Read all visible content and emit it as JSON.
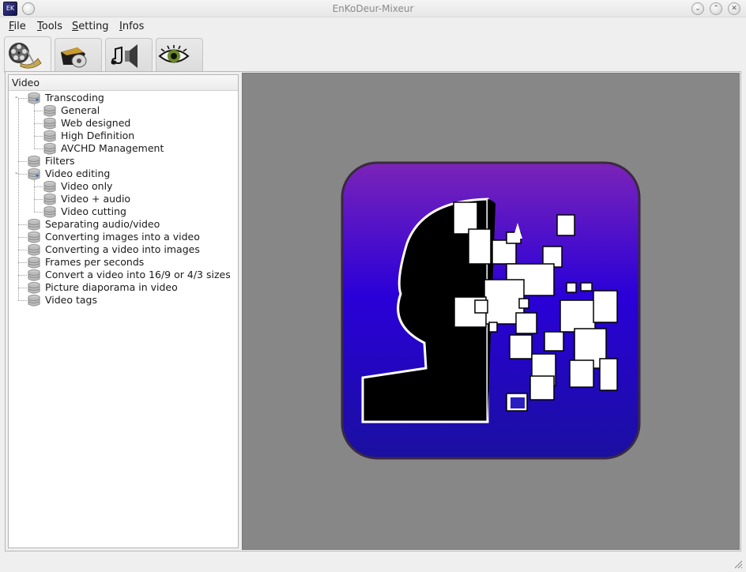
{
  "window": {
    "title": "EnKoDeur-Mixeur",
    "app_icon_label": "EK"
  },
  "menu": {
    "file": {
      "mnemonic": "F",
      "rest": "ile"
    },
    "tools": {
      "mnemonic": "T",
      "rest": "ools"
    },
    "setting": {
      "mnemonic": "S",
      "rest": "etting"
    },
    "infos": {
      "mnemonic": "I",
      "rest": "nfos"
    }
  },
  "tabs": [
    {
      "icon": "film-reel-icon",
      "active": true
    },
    {
      "icon": "camera-disc-icon",
      "active": false
    },
    {
      "icon": "music-speaker-icon",
      "active": false
    },
    {
      "icon": "eye-icon",
      "active": false
    }
  ],
  "tree": {
    "header": "Video",
    "items": [
      {
        "label": "Transcoding",
        "level": 0,
        "expanded": true
      },
      {
        "label": "General",
        "level": 1
      },
      {
        "label": "Web designed",
        "level": 1
      },
      {
        "label": "High Definition",
        "level": 1
      },
      {
        "label": "AVCHD Management",
        "level": 1
      },
      {
        "label": "Filters",
        "level": 0
      },
      {
        "label": "Video editing",
        "level": 0,
        "expanded": true
      },
      {
        "label": "Video only",
        "level": 1
      },
      {
        "label": "Video + audio",
        "level": 1
      },
      {
        "label": "Video cutting",
        "level": 1
      },
      {
        "label": "Separating audio/video",
        "level": 0
      },
      {
        "label": "Converting images into a video",
        "level": 0
      },
      {
        "label": "Converting a video into images",
        "level": 0
      },
      {
        "label": "Frames per seconds",
        "level": 0
      },
      {
        "label": "Convert a video into 16/9 or 4/3 sizes",
        "level": 0
      },
      {
        "label": "Picture diaporama in video",
        "level": 0
      },
      {
        "label": "Video tags",
        "level": 0
      }
    ]
  },
  "colors": {
    "preview_bg": "#878787",
    "logo_top": "#7b24b8",
    "logo_mid": "#2a00d8",
    "logo_bottom": "#1a10a0"
  }
}
